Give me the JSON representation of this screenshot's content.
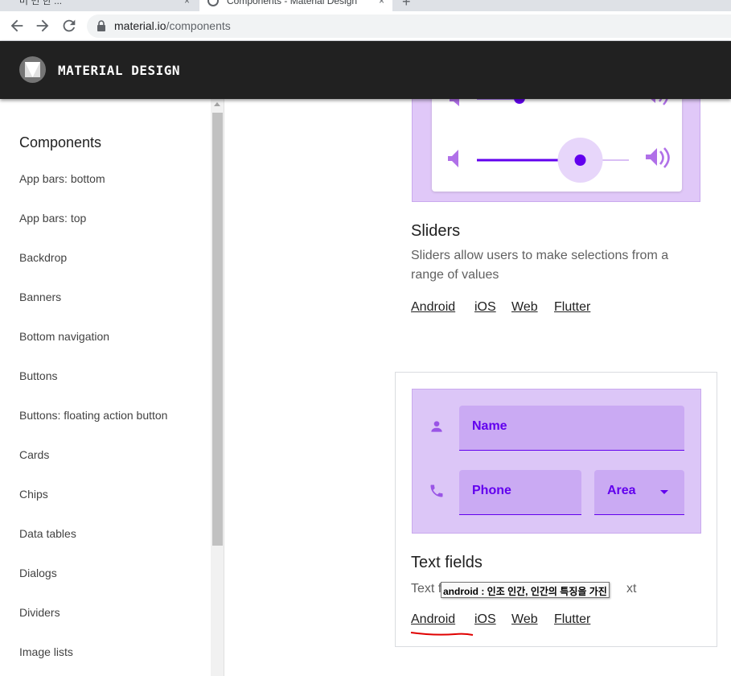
{
  "browser": {
    "inactive_tab_title": "머 번 한 ...",
    "active_tab_title": "Components - Material Design",
    "tab_close_glyph": "×",
    "new_tab_glyph": "+",
    "url_host": "material.io",
    "url_path": "/components"
  },
  "header": {
    "site_title": "MATERIAL DESIGN"
  },
  "sidebar": {
    "heading": "Components",
    "items": [
      {
        "label": "App bars: bottom"
      },
      {
        "label": "App bars: top"
      },
      {
        "label": "Backdrop"
      },
      {
        "label": "Banners"
      },
      {
        "label": "Bottom navigation"
      },
      {
        "label": "Buttons"
      },
      {
        "label": "Buttons: floating action button"
      },
      {
        "label": "Cards"
      },
      {
        "label": "Chips"
      },
      {
        "label": "Data tables"
      },
      {
        "label": "Dialogs"
      },
      {
        "label": "Dividers"
      },
      {
        "label": "Image lists"
      }
    ]
  },
  "sliders": {
    "title": "Sliders",
    "description": "Sliders allow users to make selections from a range of values",
    "links": [
      "Android",
      "iOS",
      "Web",
      "Flutter"
    ],
    "slider_value_top": 0.28,
    "slider_value_bottom": 0.68
  },
  "text_fields": {
    "title": "Text fields",
    "description_visible_start": "Text f",
    "description_visible_end": "xt",
    "links": [
      "Android",
      "iOS",
      "Web",
      "Flutter"
    ],
    "name_label": "Name",
    "phone_label": "Phone",
    "area_label": "Area"
  },
  "tooltip": {
    "text": "android : 인조 인간, 인간의 특징을 가진"
  },
  "colors": {
    "accent": "#6200ee",
    "header_bg": "#212121",
    "card_bg": "#dcc6f7",
    "annotation_red": "#e00000"
  }
}
